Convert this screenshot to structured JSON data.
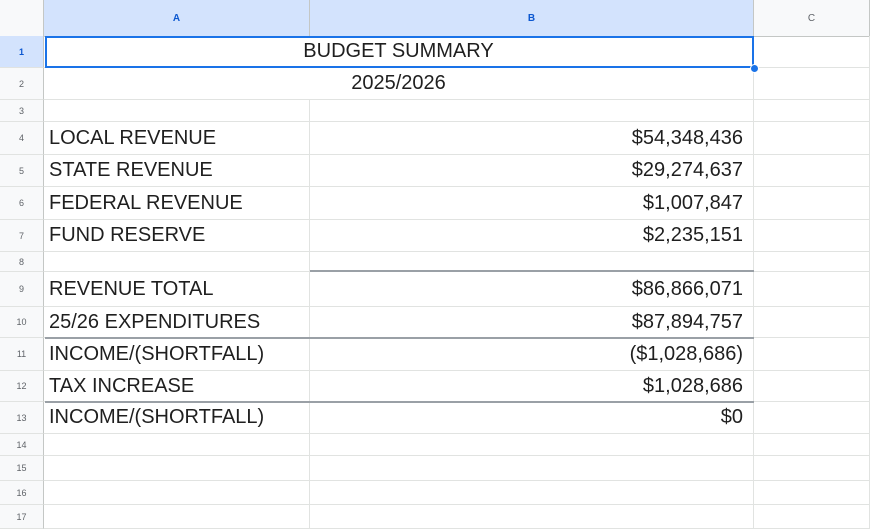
{
  "columns": [
    "A",
    "B",
    "C"
  ],
  "rows": [
    "1",
    "2",
    "3",
    "4",
    "5",
    "6",
    "7",
    "8",
    "9",
    "10",
    "11",
    "12",
    "13",
    "14",
    "15",
    "16",
    "17"
  ],
  "title": "BUDGET SUMMARY",
  "year": "2025/2026",
  "lines": [
    {
      "label": "LOCAL REVENUE",
      "value": "$54,348,436"
    },
    {
      "label": "STATE REVENUE",
      "value": "$29,274,637"
    },
    {
      "label": "FEDERAL REVENUE",
      "value": "$1,007,847"
    },
    {
      "label": "FUND RESERVE",
      "value": "$2,235,151"
    },
    {
      "label": "REVENUE TOTAL",
      "value": "$86,866,071"
    },
    {
      "label": "25/26 EXPENDITURES",
      "value": "$87,894,757"
    },
    {
      "label": "INCOME/(SHORTFALL)",
      "value": "($1,028,686)"
    },
    {
      "label": "TAX INCREASE",
      "value": "$1,028,686"
    },
    {
      "label": "INCOME/(SHORTFALL)",
      "value": "$0"
    }
  ]
}
